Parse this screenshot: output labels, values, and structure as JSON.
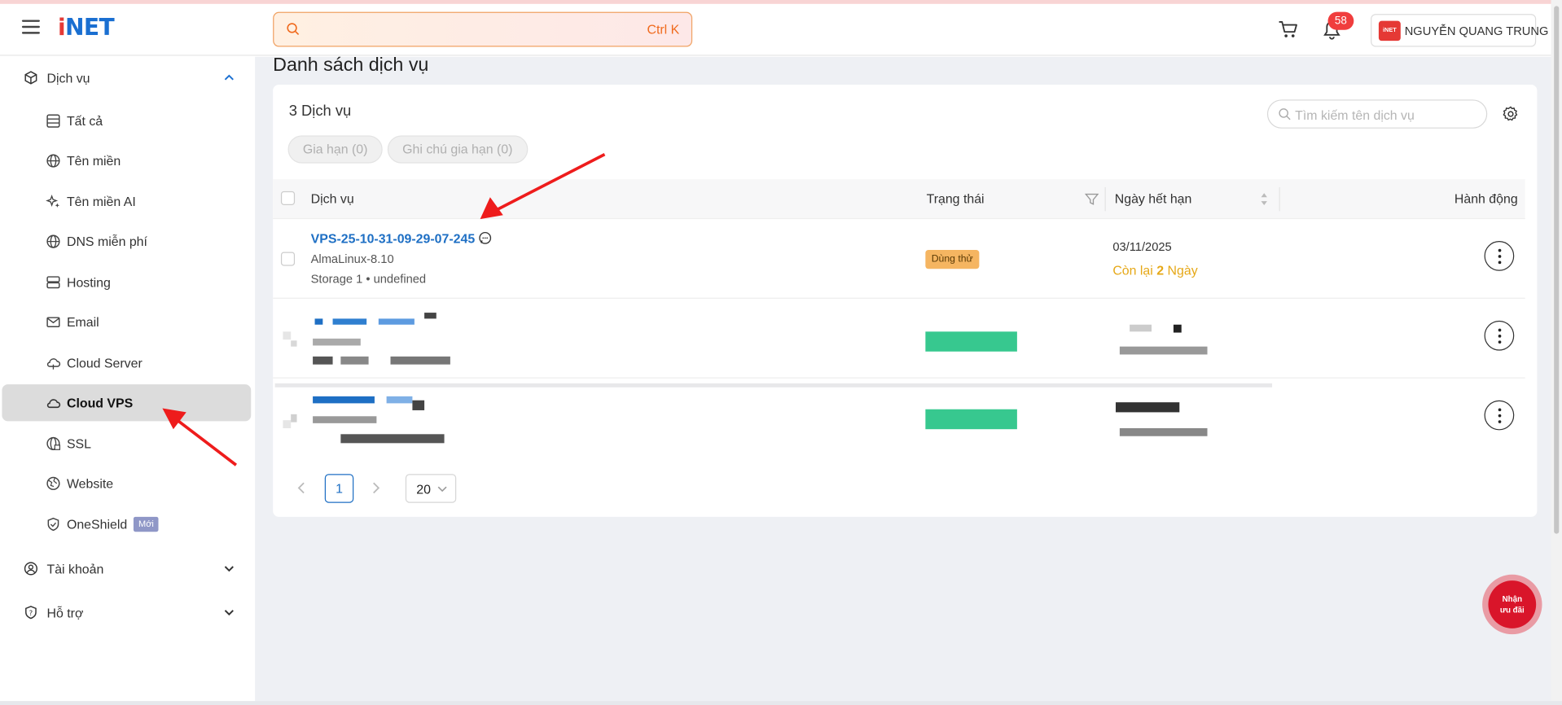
{
  "header": {
    "logo": "iNET",
    "search_placeholder": "",
    "search_shortcut": "Ctrl K",
    "notification_count": "58",
    "user_name": "NGUYỄN QUANG TRUNG",
    "mini_logo": "iNET"
  },
  "sidebar": {
    "group_services": "Dịch vụ",
    "items": [
      {
        "label": "Tất cả",
        "icon": "list-icon"
      },
      {
        "label": "Tên miền",
        "icon": "globe-icon"
      },
      {
        "label": "Tên miền AI",
        "icon": "sparkle-icon"
      },
      {
        "label": "DNS miễn phí",
        "icon": "globe-icon"
      },
      {
        "label": "Hosting",
        "icon": "server-icon"
      },
      {
        "label": "Email",
        "icon": "mail-icon"
      },
      {
        "label": "Cloud Server",
        "icon": "cloud-icon"
      },
      {
        "label": "Cloud VPS",
        "icon": "cloud-icon"
      },
      {
        "label": "SSL",
        "icon": "globe-lock-icon"
      },
      {
        "label": "Website",
        "icon": "web-icon"
      },
      {
        "label": "OneShield",
        "icon": "shield-icon"
      }
    ],
    "new_tag": "Mới",
    "group_account": "Tài khoản",
    "group_support": "Hỗ trợ"
  },
  "main": {
    "title": "Danh sách dịch vụ",
    "count_label": "3 Dịch vụ",
    "renew_btn": "Gia hạn (0)",
    "renew_note_btn": "Ghi chú gia hạn (0)",
    "table_search_placeholder": "Tìm kiếm tên dịch vụ",
    "columns": {
      "service": "Dịch vụ",
      "status": "Trạng thái",
      "expiry": "Ngày hết hạn",
      "action": "Hành động"
    },
    "row1": {
      "name": "VPS-25-10-31-09-29-07-245",
      "os": "AlmaLinux-8.10",
      "storage": "Storage 1 • undefined",
      "status": "Dùng thử",
      "expiry_date": "03/11/2025",
      "remaining_prefix": "Còn lại",
      "remaining_days": "2",
      "remaining_suffix": "Ngày"
    },
    "pagination": {
      "current_page": "1",
      "page_size": "20"
    }
  },
  "promo": {
    "line1": "Nhận",
    "line2": "ưu đãi"
  },
  "colors": {
    "brand_blue": "#1a6fd1",
    "accent_red": "#e53935",
    "status_trial": "#f5b561",
    "remaining_yellow": "#e6a817",
    "active_nav": "#dcdcdc"
  }
}
